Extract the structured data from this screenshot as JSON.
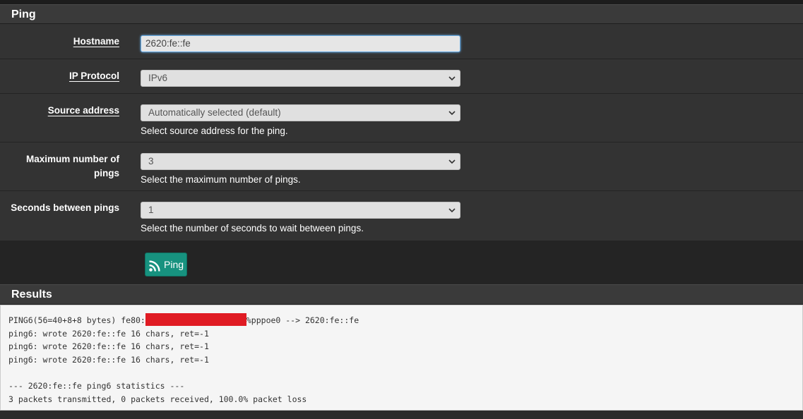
{
  "ping_panel": {
    "title": "Ping"
  },
  "form": {
    "hostname": {
      "label": "Hostname",
      "value": "2620:fe::fe"
    },
    "ip_protocol": {
      "label": "IP Protocol",
      "selected": "IPv6"
    },
    "source_address": {
      "label": "Source address",
      "selected": "Automatically selected (default)",
      "help": "Select source address for the ping."
    },
    "max_pings": {
      "label_line1": "Maximum number of",
      "label_line2": "pings",
      "selected": "3",
      "help": "Select the maximum number of pings."
    },
    "seconds_between": {
      "label": "Seconds between pings",
      "selected": "1",
      "help": "Select the number of seconds to wait between pings."
    }
  },
  "actions": {
    "ping_button_label": "Ping",
    "ping_button_icon": "rss-icon"
  },
  "results_panel": {
    "title": "Results",
    "line1_prefix": "PING6(56=40+8+8 bytes) fe80:",
    "line1_suffix": "%pppoe0 --> 2620:fe::fe",
    "lines": [
      "ping6: wrote 2620:fe::fe 16 chars, ret=-1",
      "ping6: wrote 2620:fe::fe 16 chars, ret=-1",
      "ping6: wrote 2620:fe::fe 16 chars, ret=-1",
      "",
      "--- 2620:fe::fe ping6 statistics ---",
      "3 packets transmitted, 0 packets received, 100.0% packet loss"
    ]
  },
  "colors": {
    "ping_button": "#17927f",
    "redaction": "#e01b23"
  }
}
